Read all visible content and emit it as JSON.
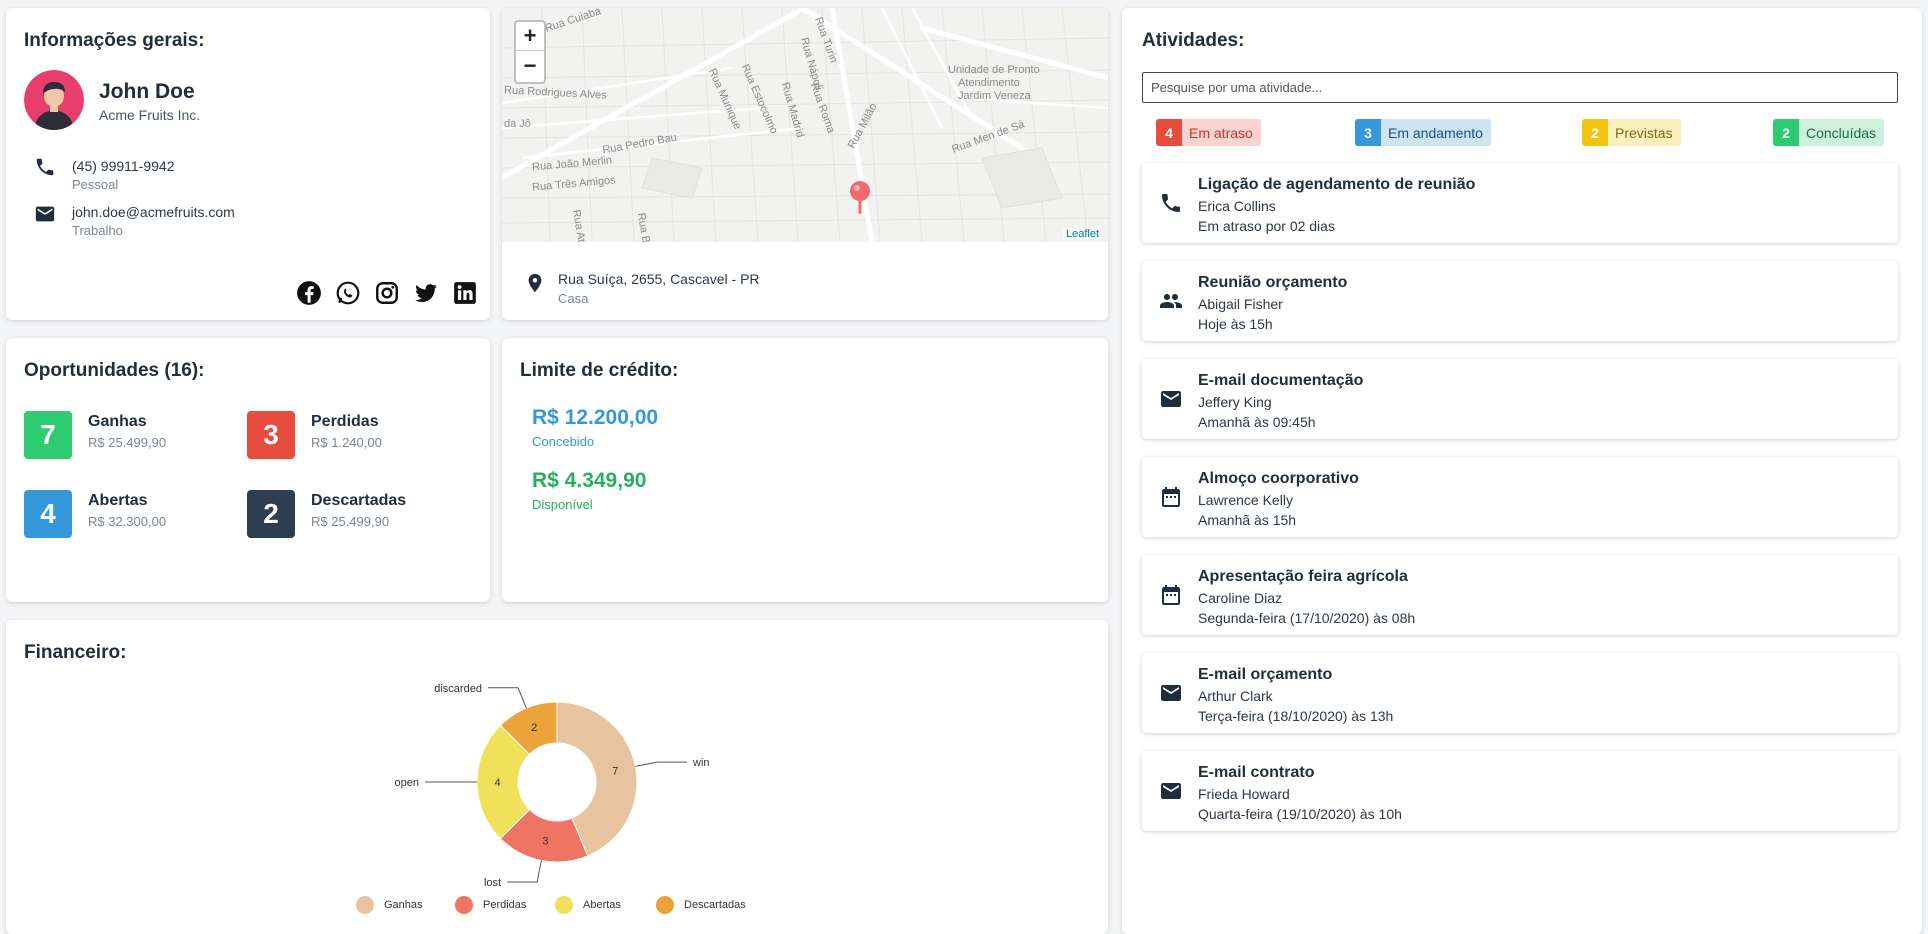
{
  "info": {
    "title": "Informações gerais:",
    "name": "John Doe",
    "company": "Acme Fruits Inc.",
    "phone": "(45) 99911-9942",
    "phone_type": "Pessoal",
    "email": "john.doe@acmefruits.com",
    "email_type": "Trabalho",
    "social_icons": [
      "facebook-icon",
      "whatsapp-icon",
      "instagram-icon",
      "twitter-icon",
      "linkedin-icon"
    ]
  },
  "map": {
    "zoom_in": "+",
    "zoom_out": "−",
    "attribution": "Leaflet",
    "streets": [
      "Rua Cuiabá",
      "Rua Rodrigues Alves",
      "da Jô",
      "Rua Pedro Bau",
      "Rua João Merlin",
      "Rua Três Amigos",
      "Rua Munique",
      "Rua Estocolmo",
      "Rua Madrid",
      "Rua Nápoli",
      "Rua Roma",
      "Rua Turin",
      "Rua Milão",
      "Rua Men de Sá",
      "Unidade de Pronto",
      "Atendimento",
      "Jardim Veneza",
      "Rua At",
      "Rua B"
    ],
    "address": "Rua Suíça, 2655, Cascavel - PR",
    "address_type": "Casa"
  },
  "opportunities": {
    "title": "Oportunidades (16):",
    "items": [
      {
        "count": "7",
        "label": "Ganhas",
        "value": "R$ 25.499,90",
        "color": "#2ecc71"
      },
      {
        "count": "3",
        "label": "Perdidas",
        "value": "R$ 1.240,00",
        "color": "#e74c3c"
      },
      {
        "count": "4",
        "label": "Abertas",
        "value": "R$ 32.300,00",
        "color": "#3498db"
      },
      {
        "count": "2",
        "label": "Descartadas",
        "value": "R$ 25.499,90",
        "color": "#2c3e50"
      }
    ]
  },
  "credit": {
    "title": "Limite de crédito:",
    "granted_value": "R$ 12.200,00",
    "granted_label": "Concebido",
    "available_value": "R$ 4.349,90",
    "available_label": "Disponível",
    "granted_color": "#3498db",
    "available_color": "#27ae60"
  },
  "financeiro": {
    "title": "Financeiro:"
  },
  "chart_data": {
    "type": "pie",
    "donut": true,
    "slices": [
      {
        "label": "win",
        "value": 7,
        "color": "#e8c3a0"
      },
      {
        "label": "lost",
        "value": 3,
        "color": "#ef7461"
      },
      {
        "label": "open",
        "value": 4,
        "color": "#f0e05a"
      },
      {
        "label": "discarded",
        "value": 2,
        "color": "#eba43c"
      }
    ],
    "legend": [
      "Ganhas",
      "Perdidas",
      "Abertas",
      "Descartadas"
    ],
    "legend_position": "bottom"
  },
  "activities": {
    "title": "Atividades:",
    "search_placeholder": "Pesquise por uma atividade...",
    "filters": [
      {
        "count": "4",
        "label": "Em atraso",
        "color": "#e74c3c",
        "bg": "#f8d3cf",
        "text": "#c0392b"
      },
      {
        "count": "3",
        "label": "Em andamento",
        "color": "#3498db",
        "bg": "#cde4f5",
        "text": "#1f4e79"
      },
      {
        "count": "2",
        "label": "Previstas",
        "color": "#f1c40f",
        "bg": "#fbefbd",
        "text": "#7a6a10"
      },
      {
        "count": "2",
        "label": "Concluídas",
        "color": "#2ecc71",
        "bg": "#cdf2dc",
        "text": "#1e6b3e"
      }
    ],
    "items": [
      {
        "icon": "phone-icon",
        "title": "Ligação de agendamento de reunião",
        "person": "Erica Collins",
        "when": "Em atraso por 02 dias"
      },
      {
        "icon": "people-icon",
        "title": "Reunião orçamento",
        "person": "Abigail Fisher",
        "when": "Hoje às 15h"
      },
      {
        "icon": "mail-icon",
        "title": "E-mail documentação",
        "person": "Jeffery King",
        "when": "Amanhã às 09:45h"
      },
      {
        "icon": "calendar-icon",
        "title": "Almoço coorporativo",
        "person": "Lawrence Kelly",
        "when": "Amanhã às 15h"
      },
      {
        "icon": "calendar-icon",
        "title": "Apresentação feira agrícola",
        "person": "Caroline Diaz",
        "when": "Segunda-feira (17/10/2020) às 08h"
      },
      {
        "icon": "mail-icon",
        "title": "E-mail orçamento",
        "person": "Arthur Clark",
        "when": "Terça-feira (18/10/2020) às 13h"
      },
      {
        "icon": "mail-icon",
        "title": "E-mail contrato",
        "person": "Frieda Howard",
        "when": "Quarta-feira (19/10/2020) às 10h"
      }
    ]
  }
}
